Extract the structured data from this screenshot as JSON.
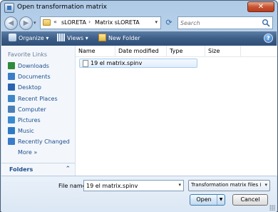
{
  "window": {
    "title": "Open transformation matrix",
    "close_symbol": "✕"
  },
  "address_bar": {
    "overflow": "«",
    "crumbs": [
      "sLORETA",
      "Matrix sLORETA"
    ],
    "separator": "›"
  },
  "search": {
    "placeholder": "Search"
  },
  "toolbar": {
    "organize": "Organize",
    "views": "Views",
    "new_folder": "New Folder",
    "help": "?",
    "dropdown_arrow": "▾"
  },
  "nav_pane": {
    "header": "Favorite Links",
    "items": [
      {
        "label": "Downloads",
        "icon": "downloads-icon",
        "color": "#2f8a3a"
      },
      {
        "label": "Documents",
        "icon": "documents-icon",
        "color": "#3a7cc8"
      },
      {
        "label": "Desktop",
        "icon": "desktop-icon",
        "color": "#2a63b2"
      },
      {
        "label": "Recent Places",
        "icon": "recent-places-icon",
        "color": "#3f86c9"
      },
      {
        "label": "Computer",
        "icon": "computer-icon",
        "color": "#4a7fb8"
      },
      {
        "label": "Pictures",
        "icon": "pictures-icon",
        "color": "#3a8bd0"
      },
      {
        "label": "Music",
        "icon": "music-icon",
        "color": "#2e7bc4"
      },
      {
        "label": "Recently Changed",
        "icon": "recently-changed-icon",
        "color": "#3a7cc8"
      }
    ],
    "more": "More",
    "more_arrows": "»",
    "folders": "Folders",
    "folders_chevron": "⌃"
  },
  "file_list": {
    "columns": [
      "Name",
      "Date modified",
      "Type",
      "Size"
    ],
    "files": [
      {
        "name": "19 el matrix.spinv"
      }
    ]
  },
  "bottom": {
    "file_name_label": "File name:",
    "file_name_value": "19 el matrix.spinv",
    "file_type": "Transformation matrix files (*.s",
    "open": "Open",
    "cancel": "Cancel"
  },
  "colors": {
    "toolbar": "#3c5d86",
    "link": "#1e4e8c",
    "selection_border": "#a7cdf0"
  }
}
